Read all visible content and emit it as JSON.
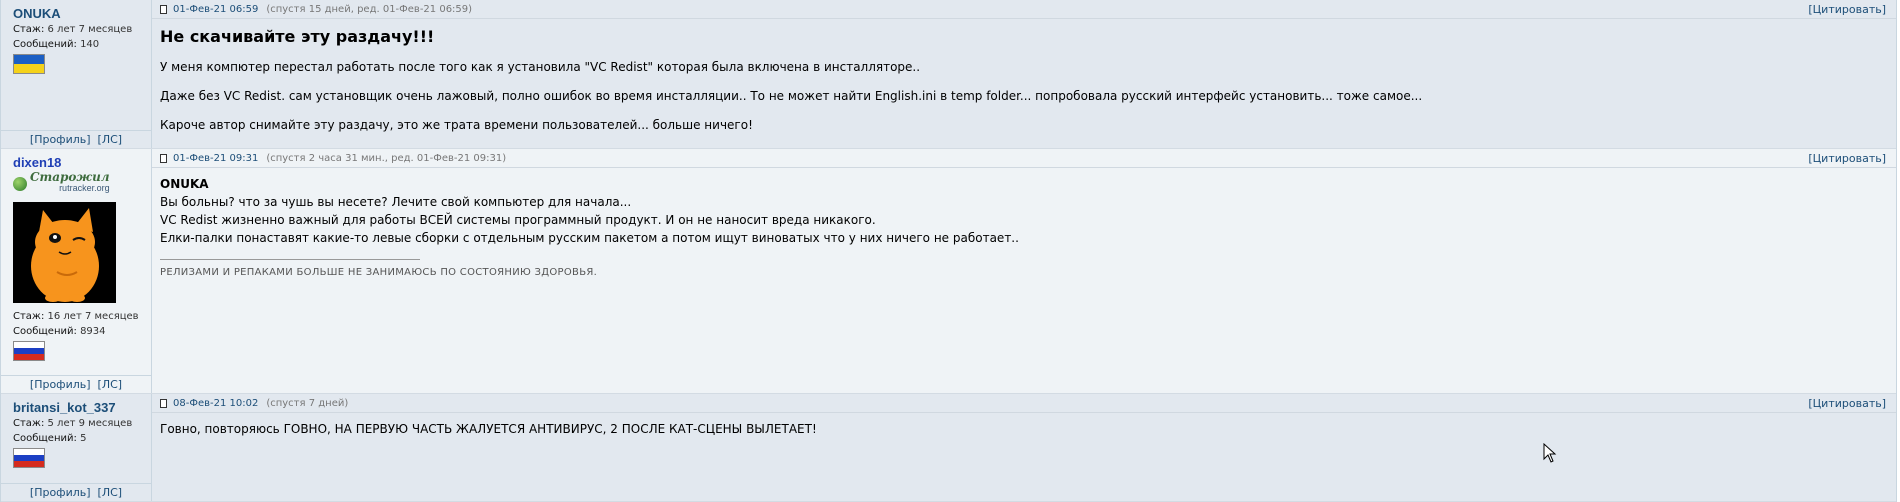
{
  "posts": [
    {
      "author": {
        "nick": "ONUKA",
        "stazh_label": "Стаж:",
        "stazh_value": "6 лет 7 месяцев",
        "msgs_label": "Сообщений:",
        "msgs_value": "140",
        "flag": "ukraine",
        "profile_link": "[Профиль]",
        "pm_link": "[ЛС]"
      },
      "date": "01-Фев-21 06:59",
      "meta": "(спустя 15 дней, ред. 01-Фев-21 06:59)",
      "quote_label": "[Цитировать]",
      "title": "Не скачивайте эту раздачу!!!",
      "paragraphs": [
        "У меня компютер перестал работать после того как я установила \"VC Redist\" которая была включена в инсталляторе..",
        "Даже без VC Redist. сам установщик очень лажовый, полно ошибок во время инсталляции.. То не может найти English.ini в temp folder... попробовала русский интерфейс установить... тоже самое...",
        "Кароче автор снимайте эту раздачу, это же трата времени пользователей... больше ничего!"
      ]
    },
    {
      "author": {
        "nick": "dixen18",
        "badge_title": "Старожил",
        "badge_site": "rutracker.org",
        "stazh_label": "Стаж:",
        "stazh_value": "16 лет 7 месяцев",
        "msgs_label": "Сообщений:",
        "msgs_value": "8934",
        "flag": "russia",
        "profile_link": "[Профиль]",
        "pm_link": "[ЛС]"
      },
      "date": "01-Фев-21 09:31",
      "meta": "(спустя 2 часа 31 мин., ред. 01-Фев-21 09:31)",
      "quote_label": "[Цитировать]",
      "quote_name": "ONUKA",
      "lines": [
        "Вы больны? что за чушь вы несете? Лечите свой компьютер для начала...",
        "VC Redist жизненно важный для работы ВСЕЙ системы программный продукт. И он не наносит вреда никакого.",
        "Елки-палки понаставят какие-то левые сборки с отдельным русским пакетом а потом ищут виноватых что у них ничего не работает.."
      ],
      "signature": "РЕЛИЗАМИ И РЕПАКАМИ БОЛЬШЕ НЕ ЗАНИМАЮСЬ ПО СОСТОЯНИЮ ЗДОРОВЬЯ."
    },
    {
      "author": {
        "nick": "britansi_kot_337",
        "stazh_label": "Стаж:",
        "stazh_value": "5 лет 9 месяцев",
        "msgs_label": "Сообщений:",
        "msgs_value": "5",
        "flag": "russia",
        "profile_link": "[Профиль]",
        "pm_link": "[ЛС]"
      },
      "date": "08-Фев-21 10:02",
      "meta": "(спустя 7 дней)",
      "quote_label": "[Цитировать]",
      "text": "Говно, повторяюсь ГОВНО, НА ПЕРВУЮ ЧАСТЬ ЖАЛУЕТСЯ АНТИВИРУС, 2 ПОСЛЕ КАТ-СЦЕНЫ ВЫЛЕТАЕТ!"
    }
  ],
  "colors": {
    "nick": "#1c4e78",
    "nick_alt": "#1f3fb5",
    "row_alt": "#e2e8ef",
    "row_norm": "#eff3f6",
    "avatar_cat": "#f7941d"
  }
}
